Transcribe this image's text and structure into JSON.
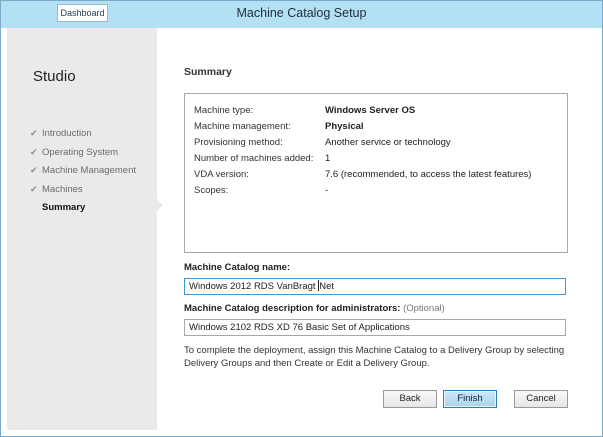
{
  "window": {
    "title": "Machine Catalog Setup",
    "taskbar_button": "Dashboard"
  },
  "sidebar": {
    "heading": "Studio",
    "steps": [
      {
        "label": "Introduction",
        "done": true
      },
      {
        "label": "Operating System",
        "done": true
      },
      {
        "label": "Machine Management",
        "done": true
      },
      {
        "label": "Machines",
        "done": true
      },
      {
        "label": "Summary",
        "done": false,
        "active": true
      }
    ]
  },
  "main": {
    "section_title": "Summary",
    "summary": [
      {
        "key": "Machine type:",
        "value": "Windows Server OS"
      },
      {
        "key": "Machine management:",
        "value": "Physical"
      },
      {
        "key": "Provisioning method:",
        "value": "Another service or technology"
      },
      {
        "key": "Number of machines added:",
        "value": "1"
      },
      {
        "key": "VDA version:",
        "value": "7.6 (recommended, to access the latest features)"
      },
      {
        "key": "Scopes:",
        "value": "-"
      }
    ],
    "catalog_name_label": "Machine Catalog name:",
    "catalog_name_value_before": "Windows 2012 RDS VanBragt",
    "catalog_name_value_after": "Net",
    "description_label": "Machine Catalog description for administrators:",
    "description_optional": "(Optional)",
    "description_value": "Windows 2102 RDS XD 76 Basic Set of Applications",
    "help_text": "To complete the deployment, assign this Machine Catalog to a Delivery Group by selecting Delivery Groups and then Create or Edit a Delivery Group."
  },
  "buttons": {
    "back": "Back",
    "finish": "Finish",
    "cancel": "Cancel"
  },
  "colors": {
    "titlebar": "#b3e0f2",
    "sidebar": "#eaeaea",
    "primary_button": "#a9d3f0",
    "focus_border": "#3f9ad4"
  }
}
